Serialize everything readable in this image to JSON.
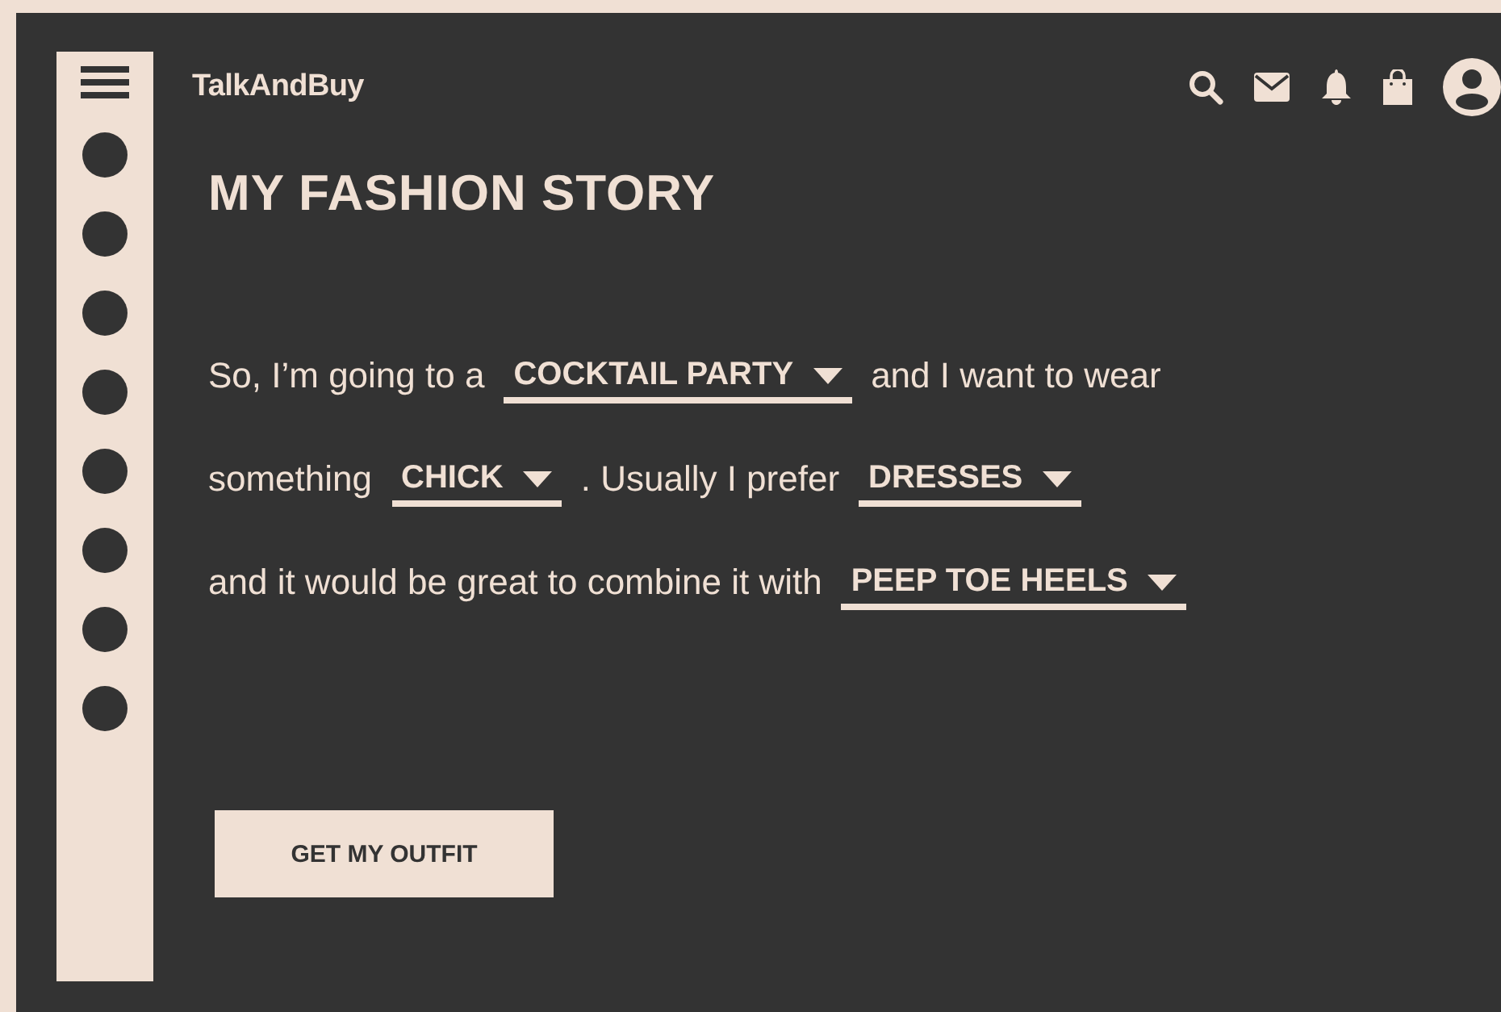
{
  "header": {
    "logo": "TalkAndBuy"
  },
  "title": "MY FASHION STORY",
  "story": [
    [
      {
        "kind": "text",
        "text": "So, I’m going to a"
      },
      {
        "kind": "select",
        "value": "COCKTAIL PARTY"
      },
      {
        "kind": "text",
        "text": "and I want to wear"
      }
    ],
    [
      {
        "kind": "text",
        "text": "something"
      },
      {
        "kind": "select",
        "value": "CHICK"
      },
      {
        "kind": "text",
        "text": ". Usually I prefer"
      },
      {
        "kind": "select",
        "value": "DRESSES"
      }
    ],
    [
      {
        "kind": "text",
        "text": "and it would be great to combine it with"
      },
      {
        "kind": "select",
        "value": "PEEP TOE HEELS"
      }
    ]
  ],
  "button": "GET MY OUTFIT"
}
